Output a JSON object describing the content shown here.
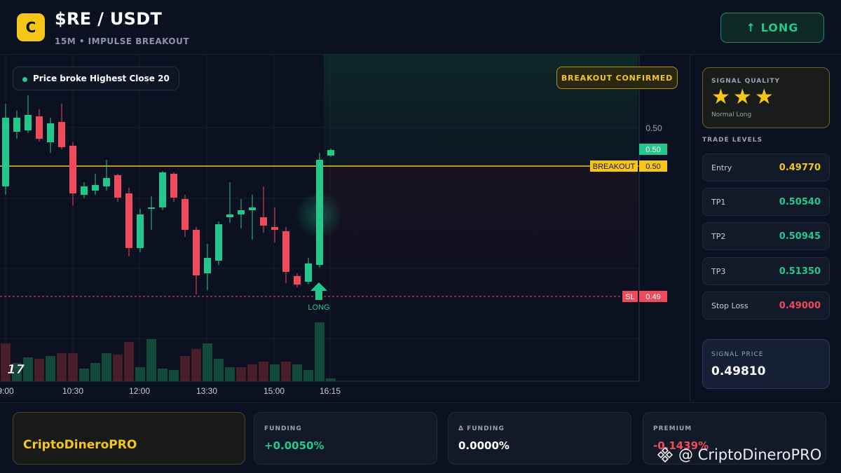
{
  "header": {
    "logo_letter": "C",
    "pair": "$RE / USDT",
    "subtitle": "15M • IMPULSE BREAKOUT",
    "direction_button": "↑ LONG"
  },
  "chart": {
    "badge_text": "Price broke Highest Close 20",
    "confirm_text": "BREAKOUT CONFIRMED",
    "price_axis_top": "0.50",
    "price_tag_current": "0.50",
    "breakout_label": "BREAKOUT",
    "breakout_value": "0.50",
    "sl_label": "SL",
    "sl_value": "0.49",
    "signal_marker": "LONG",
    "tv_logo": "17",
    "time_labels": [
      "9:00",
      "10:30",
      "12:00",
      "13:30",
      "15:00",
      "16:15"
    ],
    "colors": {
      "up": "#22c98a",
      "down": "#f04a5a",
      "breakout": "#f5c518"
    }
  },
  "sidebar": {
    "quality_title": "SIGNAL QUALITY",
    "stars": 3,
    "quality_sub": "Normal Long",
    "levels_title": "TRADE LEVELS",
    "levels": [
      {
        "label": "Entry",
        "value": "0.49770",
        "color": "#f5c518"
      },
      {
        "label": "TP1",
        "value": "0.50540",
        "color": "#22c98a"
      },
      {
        "label": "TP2",
        "value": "0.50945",
        "color": "#22c98a"
      },
      {
        "label": "TP3",
        "value": "0.51350",
        "color": "#22c98a"
      },
      {
        "label": "Stop Loss",
        "value": "0.49000",
        "color": "#f04a5a"
      }
    ],
    "signal_price_label": "SIGNAL PRICE",
    "signal_price_value": "0.49810"
  },
  "footer": {
    "brand": "CriptoDineroPRO",
    "stats": [
      {
        "label": "FUNDING",
        "value": "+0.0050%",
        "color": "#22c98a"
      },
      {
        "label": "Δ FUNDING",
        "value": "0.0000%",
        "color": "#ffffff"
      },
      {
        "label": "PREMIUM",
        "value": "-0.1439%",
        "color": "#f04a5a"
      }
    ],
    "watermark": "@ CriptoDineroPRO"
  }
}
